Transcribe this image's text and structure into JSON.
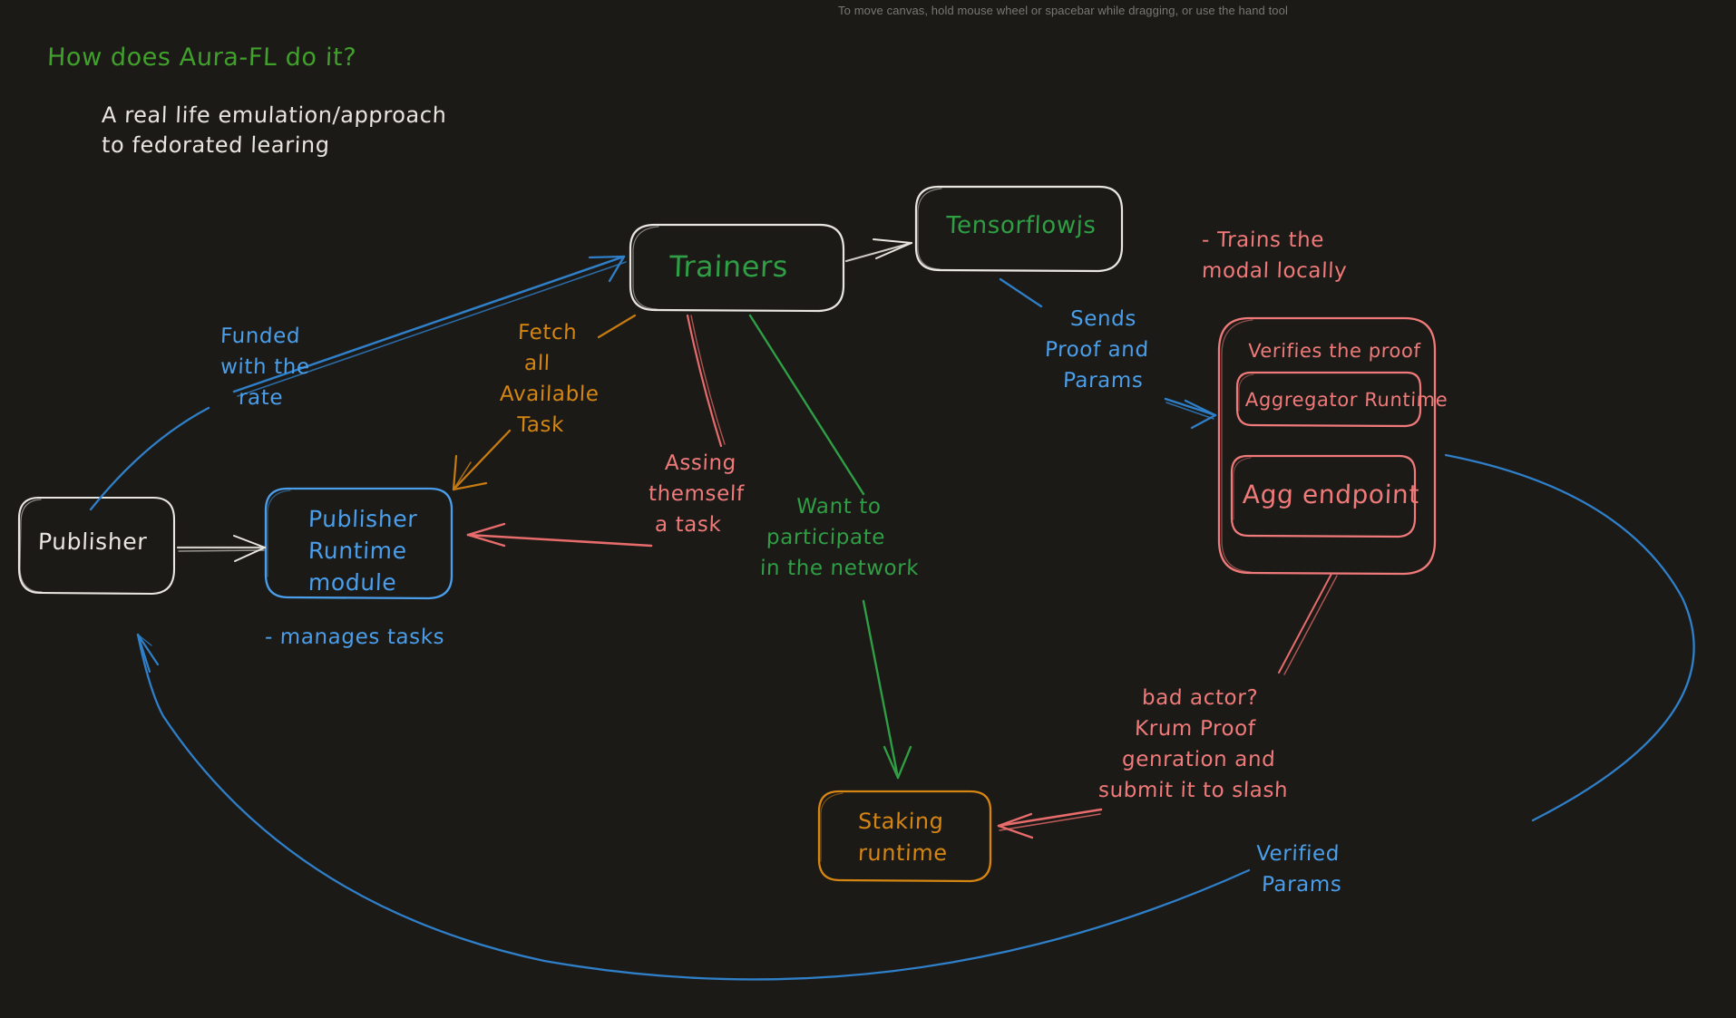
{
  "app": {
    "canvas_hint": "To move canvas, hold mouse wheel or spacebar while dragging, or use the hand tool",
    "background_color": "#1b1a17"
  },
  "colors": {
    "green": "#2f9e44",
    "white": "#e9e6e0",
    "blue": "#4a9eea",
    "orange": "#d58512",
    "red": "#f07a7a"
  },
  "headings": {
    "title": "How does Aura-FL do it?",
    "subtitle_line1": "A real life emulation/approach",
    "subtitle_line2": "to fedorated learing"
  },
  "nodes": {
    "trainers": {
      "label": "Trainers",
      "color": "#2f9e44",
      "border": "#e9e6e0"
    },
    "tensorflowjs": {
      "label": "Tensorflowjs",
      "color": "#2f9e44",
      "border": "#e9e6e0"
    },
    "publisher": {
      "label": "Publisher",
      "color": "#e9e6e0",
      "border": "#e9e6e0"
    },
    "publisher_runtime": {
      "line1": "Publisher",
      "line2": "Runtime",
      "line3": "module",
      "color": "#4a9eea",
      "border": "#4a9eea"
    },
    "staking_runtime": {
      "line1": "Staking",
      "line2": "runtime",
      "color": "#d58512",
      "border": "#d58512"
    },
    "aggregator_group": {
      "caption": "Verifies the proof",
      "inner_top": "Aggregator Runtime",
      "inner_bottom": "Agg endpoint",
      "color": "#f07a7a",
      "border": "#f07a7a"
    }
  },
  "annotations": {
    "funded": {
      "lines": [
        "Funded",
        "with the",
        "rate"
      ],
      "color": "#4a9eea"
    },
    "fetch": {
      "lines": [
        "Fetch",
        "all",
        "Available",
        "Task"
      ],
      "color": "#d58512"
    },
    "assign": {
      "lines": [
        "Assing",
        "themself",
        "a task"
      ],
      "color": "#f07a7a"
    },
    "want": {
      "lines": [
        "Want to",
        "participate",
        "in the network"
      ],
      "color": "#2f9e44"
    },
    "sends": {
      "lines": [
        "Sends",
        "Proof and",
        "Params"
      ],
      "color": "#4a9eea"
    },
    "trains": {
      "lines": [
        "- Trains the",
        "modal locally"
      ],
      "color": "#f07a7a"
    },
    "bad_actor": {
      "lines": [
        "bad actor?",
        "Krum Proof",
        "genration and",
        "submit it to slash"
      ],
      "color": "#f07a7a"
    },
    "verified": {
      "lines": [
        "Verified",
        "Params"
      ],
      "color": "#4a9eea"
    },
    "manages": {
      "lines": [
        "- manages tasks"
      ],
      "color": "#4a9eea"
    }
  },
  "edges": [
    {
      "name": "publisher-to-trainers",
      "label": "Funded with the rate",
      "color": "#4a9eea"
    },
    {
      "name": "publisher-to-publisher-runtime",
      "label": "",
      "color": "#e9e6e0"
    },
    {
      "name": "trainers-to-publisher-runtime",
      "label": "Fetch all Available Task",
      "color": "#d58512"
    },
    {
      "name": "trainers-assign-task",
      "label": "Assing themself a task",
      "color": "#f07a7a"
    },
    {
      "name": "trainers-to-staking",
      "label": "Want to participate in the network",
      "color": "#2f9e44"
    },
    {
      "name": "trainers-to-tensorflowjs",
      "label": "",
      "color": "#e9e6e0"
    },
    {
      "name": "tensorflowjs-to-aggregator",
      "label": "Sends Proof and Params",
      "color": "#4a9eea"
    },
    {
      "name": "aggregator-to-staking",
      "label": "bad actor? Krum Proof genration and submit it to slash",
      "color": "#f07a7a"
    },
    {
      "name": "aggregator-to-publisher",
      "label": "Verified Params",
      "color": "#4a9eea"
    }
  ]
}
